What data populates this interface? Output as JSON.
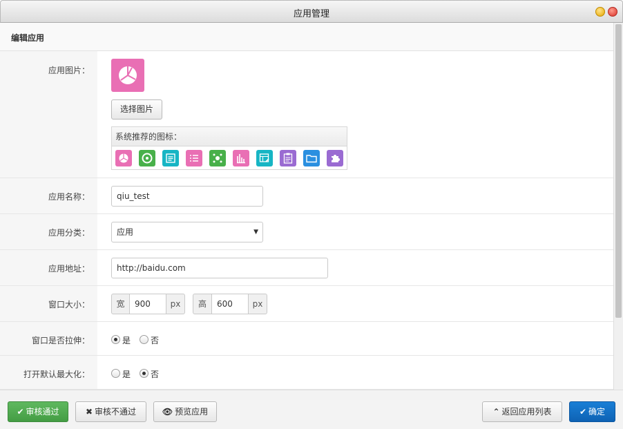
{
  "window": {
    "title": "应用管理"
  },
  "header": {
    "title": "编辑应用"
  },
  "form": {
    "app_image": {
      "label": "应用图片：",
      "choose_button": "选择图片",
      "recommended_title": "系统推荐的图标：",
      "current_icon": {
        "name": "pie-chart-icon",
        "color": "#e96fb4"
      },
      "icons": [
        {
          "name": "pie-chart-icon",
          "color": "#e96fb4"
        },
        {
          "name": "donut-icon",
          "color": "#48b04a"
        },
        {
          "name": "document-icon",
          "color": "#17b5c4"
        },
        {
          "name": "list-icon",
          "color": "#e96fb4"
        },
        {
          "name": "network-icon",
          "color": "#48b04a"
        },
        {
          "name": "bar-chart-icon",
          "color": "#e96fb4"
        },
        {
          "name": "table-edit-icon",
          "color": "#17b5c4"
        },
        {
          "name": "clipboard-icon",
          "color": "#9a6bd2"
        },
        {
          "name": "folder-icon",
          "color": "#2a8fe0"
        },
        {
          "name": "puzzle-icon",
          "color": "#9a6bd2"
        }
      ]
    },
    "app_name": {
      "label": "应用名称：",
      "value": "qiu_test"
    },
    "app_category": {
      "label": "应用分类：",
      "value": "应用"
    },
    "app_url": {
      "label": "应用地址：",
      "value": "http://baidu.com"
    },
    "window_size": {
      "label": "窗口大小：",
      "width_label": "宽",
      "width_value": "900",
      "height_label": "高",
      "height_value": "600",
      "unit": "px"
    },
    "window_resize": {
      "label": "窗口是否拉伸：",
      "yes": "是",
      "no": "否",
      "selected": "yes"
    },
    "default_maximize": {
      "label": "打开默认最大化：",
      "yes": "是",
      "no": "否",
      "selected": "no"
    }
  },
  "footer": {
    "approve": "审核通过",
    "reject": "审核不通过",
    "preview": "预览应用",
    "back": "返回应用列表",
    "confirm": "确定"
  }
}
